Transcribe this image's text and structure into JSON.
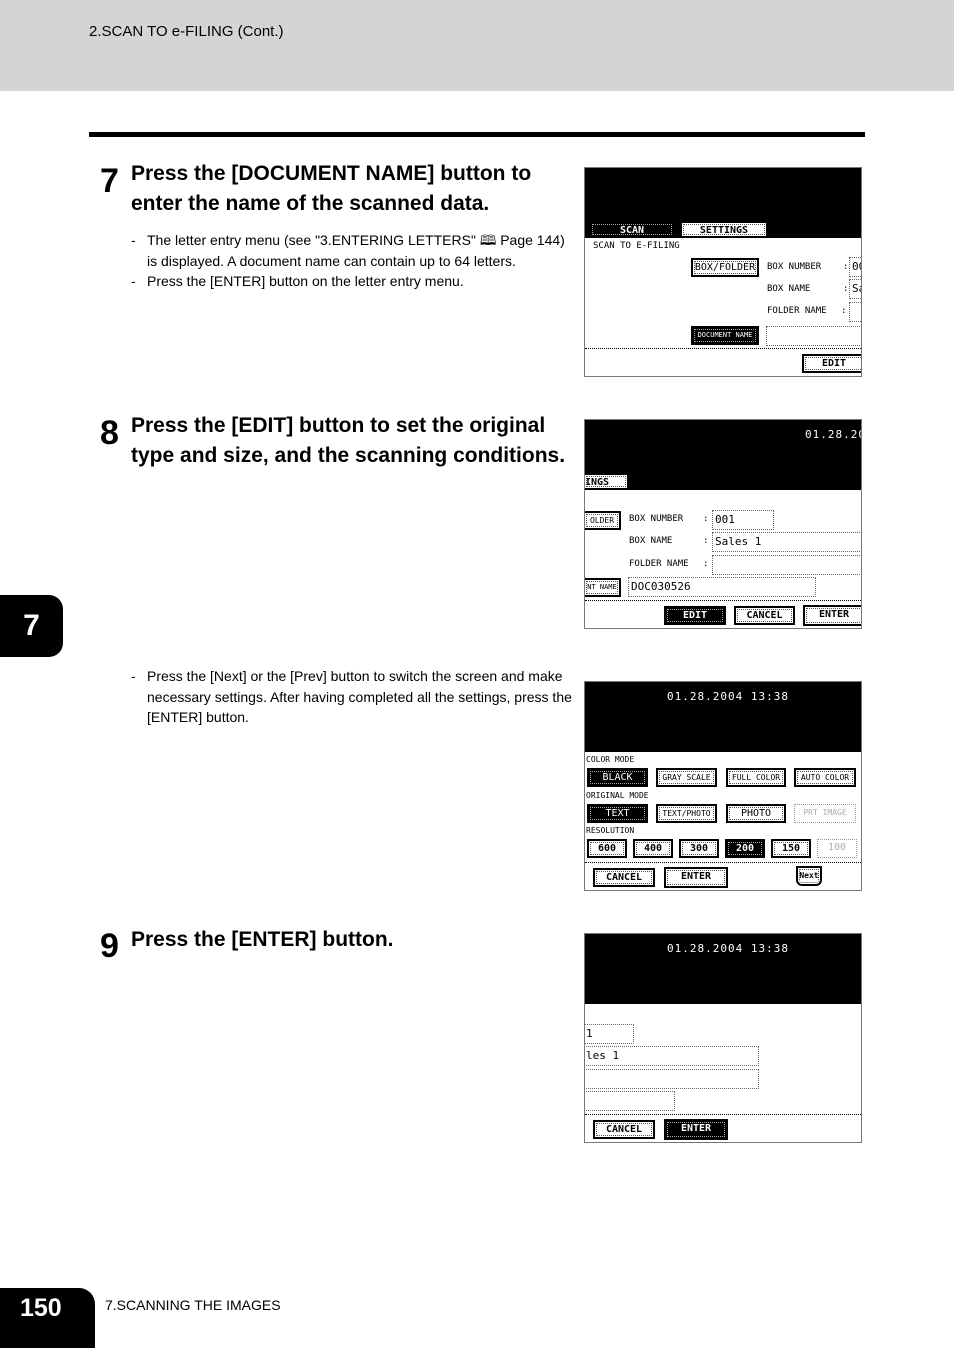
{
  "header": {
    "title": "2.SCAN TO e-FILING (Cont.)"
  },
  "chapter_tab": "7",
  "steps": [
    {
      "number": "7",
      "title": "Press the [DOCUMENT NAME] button to enter the name of the scanned data.",
      "notes": [
        "The letter entry menu (see \"3.ENTERING LETTERS\" 🕮 Page 144) is displayed. A document name can contain up to 64 letters.",
        "Press the [ENTER] button on the letter entry menu."
      ]
    },
    {
      "number": "8",
      "title": "Press the [EDIT] button to set the original type and size, and the scanning conditions.",
      "notes": [
        "Press the [Next] or the [Prev] button to switch the screen and make necessary settings. After having completed all the settings, press the [ENTER] button."
      ]
    },
    {
      "number": "9",
      "title": "Press the [ENTER] button."
    }
  ],
  "screen1": {
    "tab_scan": "SCAN",
    "tab_settings": "SETTINGS",
    "heading": "SCAN TO E-FILING",
    "box_folder": "BOX/FOLDER",
    "box_number_label": "BOX NUMBER",
    "box_name_label": "BOX NAME",
    "folder_name_label": "FOLDER NAME",
    "colon": ":",
    "box_number": "00",
    "box_name": "Sa",
    "document_name": "DOCUMENT NAME",
    "edit": "EDIT"
  },
  "screen2": {
    "date": "01.28.20",
    "tab": "INGS",
    "folder_btn": "OLDER",
    "box_number_label": "BOX NUMBER",
    "box_name_label": "BOX NAME",
    "folder_name_label": "FOLDER NAME",
    "colon": ":",
    "box_number": "001",
    "box_name": "Sales 1",
    "doc_btn": "NT NAME",
    "document_name": "DOC030526",
    "edit": "EDIT",
    "cancel": "CANCEL",
    "enter": "ENTER"
  },
  "screen3": {
    "date": "01.28.2004 13:38",
    "color_mode": "COLOR MODE",
    "color_options": [
      "BLACK",
      "GRAY SCALE",
      "FULL COLOR",
      "AUTO COLOR"
    ],
    "original_mode": "ORIGINAL MODE",
    "original_options": [
      "TEXT",
      "TEXT/PHOTO",
      "PHOTO",
      "PRT IMAGE"
    ],
    "resolution": "RESOLUTION",
    "resolution_options": [
      "600",
      "400",
      "300",
      "200",
      "150",
      "100"
    ],
    "cancel": "CANCEL",
    "enter": "ENTER",
    "next": "Next"
  },
  "screen4": {
    "date": "01.28.2004 13:38",
    "box_number": "1",
    "box_name": "les 1",
    "cancel": "CANCEL",
    "enter": "ENTER"
  },
  "footer": {
    "page": "150",
    "section": "7.SCANNING THE IMAGES"
  }
}
